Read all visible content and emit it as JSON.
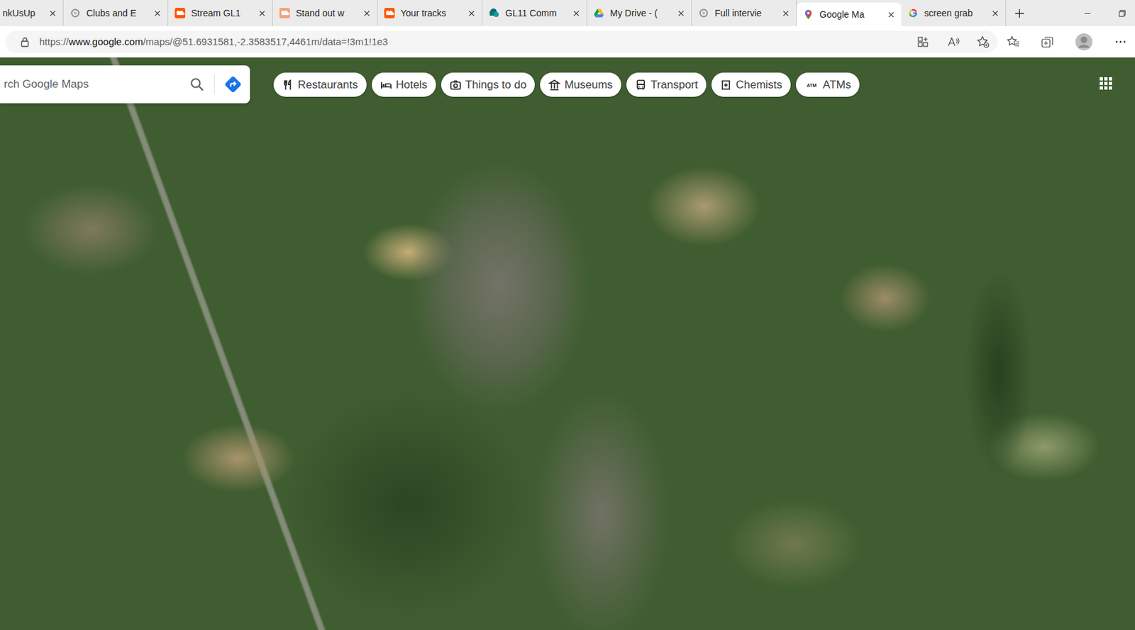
{
  "tabs": [
    {
      "label": "nkUsUp",
      "selected": false,
      "kind": "partial"
    },
    {
      "label": "Clubs and E",
      "selected": false,
      "kind": "cf"
    },
    {
      "label": "Stream GL1",
      "selected": false,
      "kind": "soundcloud"
    },
    {
      "label": "Stand out w",
      "selected": false,
      "kind": "soundcloud-light"
    },
    {
      "label": "Your tracks",
      "selected": false,
      "kind": "soundcloud"
    },
    {
      "label": "GL11 Comm",
      "selected": false,
      "kind": "sharepoint"
    },
    {
      "label": "My Drive - (",
      "selected": false,
      "kind": "drive"
    },
    {
      "label": "Full intervie",
      "selected": false,
      "kind": "cf"
    },
    {
      "label": "Google Ma",
      "selected": true,
      "kind": "maps"
    },
    {
      "label": "screen grab",
      "selected": false,
      "kind": "google"
    }
  ],
  "address_bar": {
    "url_prefix": "https://",
    "url_host": "www.google.com",
    "url_path": "/maps/@51.6931581,-2.3583517,4461m/data=!3m1!1e3"
  },
  "map": {
    "search": {
      "placeholder": "rch Google Maps"
    },
    "chips": [
      {
        "label": "Restaurants",
        "kind": "restaurant"
      },
      {
        "label": "Hotels",
        "kind": "hotel"
      },
      {
        "label": "Things to do",
        "kind": "camera"
      },
      {
        "label": "Museums",
        "kind": "museum"
      },
      {
        "label": "Transport",
        "kind": "transit"
      },
      {
        "label": "Chemists",
        "kind": "chemist"
      },
      {
        "label": "ATMs",
        "kind": "atm",
        "icon_text": "ATM"
      }
    ]
  }
}
